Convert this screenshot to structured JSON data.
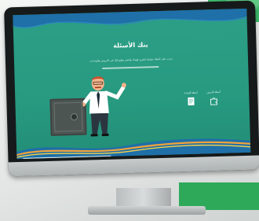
{
  "screen": {
    "title": "بنك الأسئلة",
    "subtitle": "تدرب على أسئلة متنوعة لتعزيز فهمك واختبر معلوماتك في الدروس والوحدات",
    "options": [
      {
        "label": "أسئلة الوحدة",
        "icon": "puzzle-icon"
      },
      {
        "label": "أسئلة الدرس",
        "icon": "document-icon"
      }
    ]
  },
  "colors": {
    "screen_bg": "#2a9c83",
    "wave_blue": "#1f6fa8",
    "wave_orange": "#f2a33a",
    "wave_yellow": "#f6d34a",
    "frame": "#161a1b",
    "accent_green": "#3dbb6b"
  }
}
